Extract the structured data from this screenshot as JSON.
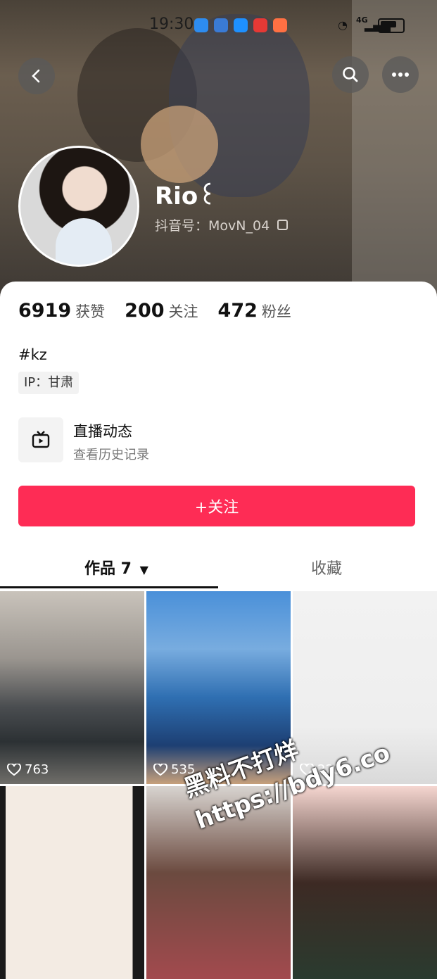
{
  "status": {
    "time": "19:30",
    "network": "4G"
  },
  "profile": {
    "name": "Rio꒰",
    "id_label": "抖音号：MovN_04",
    "bio": "#kz",
    "ip_label": "IP：甘肃"
  },
  "stats": [
    {
      "value": "6919",
      "label": "获赞"
    },
    {
      "value": "200",
      "label": "关注"
    },
    {
      "value": "472",
      "label": "粉丝"
    }
  ],
  "live": {
    "title": "直播动态",
    "subtitle": "查看历史记录"
  },
  "follow_button": "+关注",
  "tabs": {
    "works": "作品 7",
    "favorites": "收藏"
  },
  "videos": [
    {
      "likes": "763"
    },
    {
      "likes": "535"
    },
    {
      "likes": "223"
    },
    {
      "likes": ""
    },
    {
      "likes": ""
    },
    {
      "likes": ""
    }
  ],
  "watermark": {
    "line1": "黑料不打烊",
    "line2": "https://bdy6.co"
  },
  "icons": {
    "back": "chevron-left-icon",
    "search": "search-icon",
    "more": "ellipsis-icon",
    "live": "tv-icon",
    "heart": "heart-icon",
    "copy": "copy-icon"
  },
  "colors": {
    "accent": "#fe2c55"
  }
}
